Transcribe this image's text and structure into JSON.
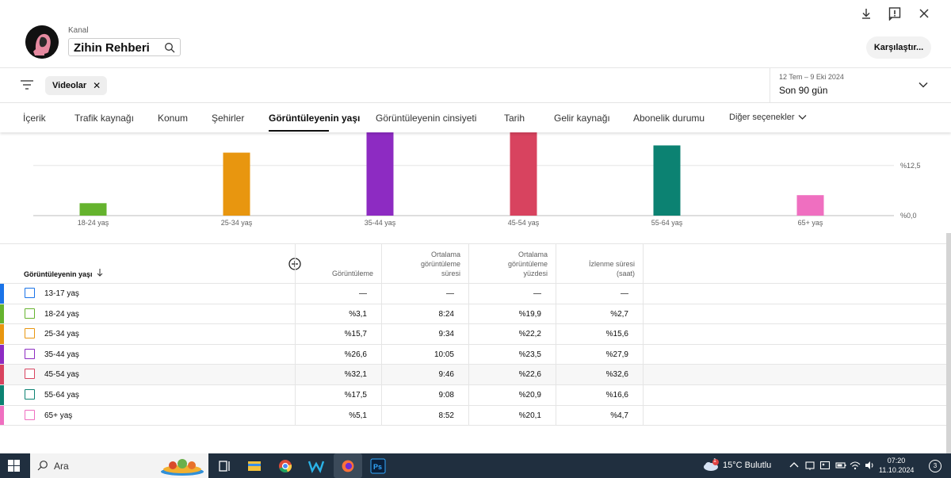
{
  "header": {
    "kanal_label": "Kanal",
    "channel_name": "Zihin Rehberi",
    "compare_label": "Karşılaştır..."
  },
  "filter": {
    "chip_label": "Videolar",
    "date_range": "12 Tem – 9 Eki 2024",
    "date_preset": "Son 90 gün"
  },
  "tabs": [
    {
      "label": "İçerik",
      "active": false
    },
    {
      "label": "Trafik kaynağı",
      "active": false
    },
    {
      "label": "Konum",
      "active": false
    },
    {
      "label": "Şehirler",
      "active": false
    },
    {
      "label": "Görüntüleyenin yaşı",
      "active": true
    },
    {
      "label": "Görüntüleyenin cinsiyeti",
      "active": false
    },
    {
      "label": "Tarih",
      "active": false
    },
    {
      "label": "Gelir kaynağı",
      "active": false
    },
    {
      "label": "Abonelik durumu",
      "active": false
    },
    {
      "label": "Diğer seçenekler",
      "active": false
    }
  ],
  "chart_data": {
    "type": "bar",
    "categories": [
      "18-24 yaş",
      "25-34 yaş",
      "35-44 yaş",
      "45-54 yaş",
      "55-64 yaş",
      "65+ yaş"
    ],
    "values": [
      3.1,
      15.7,
      26.6,
      32.1,
      17.5,
      5.1
    ],
    "colors": [
      "#65b32e",
      "#e8960f",
      "#8d2bc2",
      "#d8435f",
      "#0c8272",
      "#ef6fc0"
    ],
    "y_ticks": [
      "%12,5",
      "%0,0"
    ],
    "y_tick_values": [
      12.5,
      0
    ],
    "ylim": [
      0,
      23.5
    ],
    "grid": true
  },
  "table": {
    "header_first": "Görüntüleyenin yaşı",
    "columns": [
      [
        "Görüntüleme"
      ],
      [
        "Ortalama",
        "görüntüleme",
        "süresi"
      ],
      [
        "Ortalama",
        "görüntüleme",
        "yüzdesi"
      ],
      [
        "İzlenme süresi",
        "(saat)"
      ]
    ],
    "rows": [
      {
        "label": "13-17 yaş",
        "color": "#1a73e8",
        "values": [
          "—",
          "—",
          "—",
          "—"
        ]
      },
      {
        "label": "18-24 yaş",
        "color": "#65b32e",
        "values": [
          "%3,1",
          "8:24",
          "%19,9",
          "%2,7"
        ]
      },
      {
        "label": "25-34 yaş",
        "color": "#e8960f",
        "values": [
          "%15,7",
          "9:34",
          "%22,2",
          "%15,6"
        ]
      },
      {
        "label": "35-44 yaş",
        "color": "#8d2bc2",
        "values": [
          "%26,6",
          "10:05",
          "%23,5",
          "%27,9"
        ]
      },
      {
        "label": "45-54 yaş",
        "color": "#d8435f",
        "values": [
          "%32,1",
          "9:46",
          "%22,6",
          "%32,6"
        ]
      },
      {
        "label": "55-64 yaş",
        "color": "#0c8272",
        "values": [
          "%17,5",
          "9:08",
          "%20,9",
          "%16,6"
        ]
      },
      {
        "label": "65+ yaş",
        "color": "#ef6fc0",
        "values": [
          "%5,1",
          "8:52",
          "%20,1",
          "%4,7"
        ]
      }
    ]
  },
  "taskbar": {
    "search_placeholder": "Ara",
    "weather": "15°C  Bulutlu",
    "weather_badge": "1",
    "time": "07:20",
    "date": "11.10.2024",
    "notifications": "3"
  }
}
